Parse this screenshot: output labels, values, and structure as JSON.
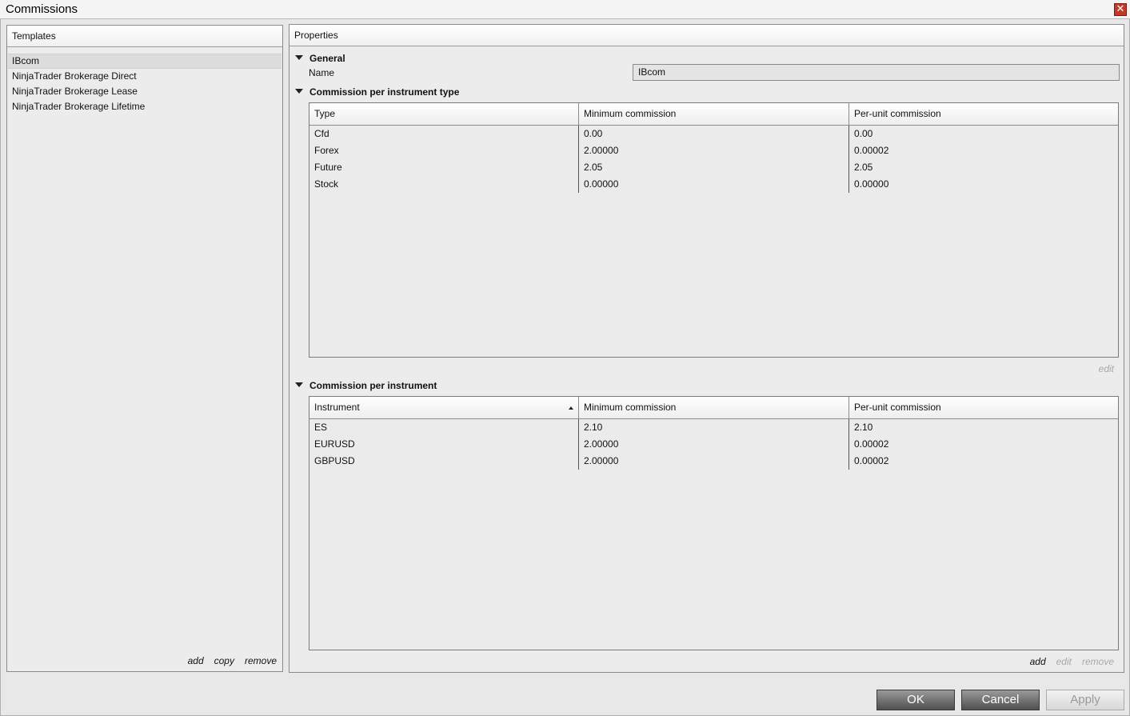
{
  "window": {
    "title": "Commissions",
    "close_glyph": "✕"
  },
  "templates": {
    "header": "Templates",
    "items": [
      {
        "label": "IBcom",
        "selected": true
      },
      {
        "label": "NinjaTrader Brokerage Direct",
        "selected": false
      },
      {
        "label": "NinjaTrader Brokerage Lease",
        "selected": false
      },
      {
        "label": "NinjaTrader Brokerage Lifetime",
        "selected": false
      }
    ],
    "actions": {
      "add": "add",
      "copy": "copy",
      "remove": "remove"
    }
  },
  "properties": {
    "header": "Properties",
    "general": {
      "title": "General",
      "name_label": "Name",
      "name_value": "IBcom"
    },
    "per_type": {
      "title": "Commission per instrument type",
      "columns": [
        "Type",
        "Minimum commission",
        "Per-unit commission"
      ],
      "rows": [
        [
          "Cfd",
          "0.00",
          "0.00"
        ],
        [
          "Forex",
          "2.00000",
          "0.00002"
        ],
        [
          "Future",
          "2.05",
          "2.05"
        ],
        [
          "Stock",
          "0.00000",
          "0.00000"
        ]
      ],
      "actions": {
        "edit": "edit"
      }
    },
    "per_instrument": {
      "title": "Commission per instrument",
      "columns": [
        "Instrument",
        "Minimum commission",
        "Per-unit commission"
      ],
      "rows": [
        [
          "ES",
          "2.10",
          "2.10"
        ],
        [
          "EURUSD",
          "2.00000",
          "0.00002"
        ],
        [
          "GBPUSD",
          "2.00000",
          "0.00002"
        ]
      ],
      "actions": {
        "add": "add",
        "edit": "edit",
        "remove": "remove"
      }
    }
  },
  "buttons": {
    "ok": "OK",
    "cancel": "Cancel",
    "apply": "Apply"
  },
  "colors": {
    "close": "#c0392b",
    "button_dark": "#4f4f4f",
    "disabled_text": "#a8a8a8"
  }
}
